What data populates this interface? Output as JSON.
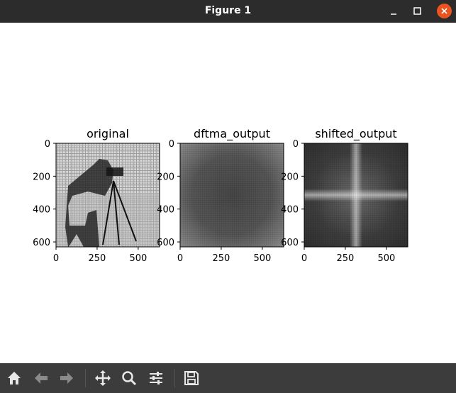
{
  "window": {
    "title": "Figure 1"
  },
  "figure": {
    "subplots": [
      {
        "title": "original"
      },
      {
        "title": "dftma_output"
      },
      {
        "title": "shifted_output"
      }
    ],
    "y_ticks": [
      "0",
      "200",
      "400",
      "600"
    ],
    "x_ticks": [
      "0",
      "250",
      "500"
    ]
  },
  "toolbar": {
    "icons": [
      "home-icon",
      "back-arrow-icon",
      "forward-arrow-icon",
      "pan-move-icon",
      "zoom-magnifier-icon",
      "configure-subplots-icon",
      "save-disk-icon"
    ]
  }
}
